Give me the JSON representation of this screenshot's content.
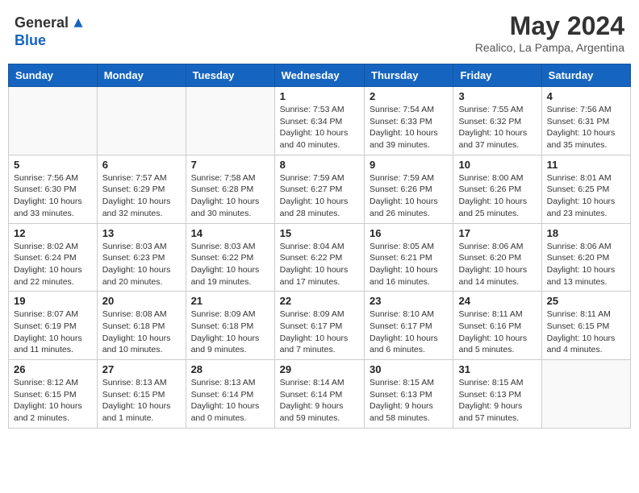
{
  "header": {
    "logo_general": "General",
    "logo_blue": "Blue",
    "month_title": "May 2024",
    "location": "Realico, La Pampa, Argentina"
  },
  "weekdays": [
    "Sunday",
    "Monday",
    "Tuesday",
    "Wednesday",
    "Thursday",
    "Friday",
    "Saturday"
  ],
  "weeks": [
    [
      {
        "day": "",
        "info": ""
      },
      {
        "day": "",
        "info": ""
      },
      {
        "day": "",
        "info": ""
      },
      {
        "day": "1",
        "info": "Sunrise: 7:53 AM\nSunset: 6:34 PM\nDaylight: 10 hours\nand 40 minutes."
      },
      {
        "day": "2",
        "info": "Sunrise: 7:54 AM\nSunset: 6:33 PM\nDaylight: 10 hours\nand 39 minutes."
      },
      {
        "day": "3",
        "info": "Sunrise: 7:55 AM\nSunset: 6:32 PM\nDaylight: 10 hours\nand 37 minutes."
      },
      {
        "day": "4",
        "info": "Sunrise: 7:56 AM\nSunset: 6:31 PM\nDaylight: 10 hours\nand 35 minutes."
      }
    ],
    [
      {
        "day": "5",
        "info": "Sunrise: 7:56 AM\nSunset: 6:30 PM\nDaylight: 10 hours\nand 33 minutes."
      },
      {
        "day": "6",
        "info": "Sunrise: 7:57 AM\nSunset: 6:29 PM\nDaylight: 10 hours\nand 32 minutes."
      },
      {
        "day": "7",
        "info": "Sunrise: 7:58 AM\nSunset: 6:28 PM\nDaylight: 10 hours\nand 30 minutes."
      },
      {
        "day": "8",
        "info": "Sunrise: 7:59 AM\nSunset: 6:27 PM\nDaylight: 10 hours\nand 28 minutes."
      },
      {
        "day": "9",
        "info": "Sunrise: 7:59 AM\nSunset: 6:26 PM\nDaylight: 10 hours\nand 26 minutes."
      },
      {
        "day": "10",
        "info": "Sunrise: 8:00 AM\nSunset: 6:26 PM\nDaylight: 10 hours\nand 25 minutes."
      },
      {
        "day": "11",
        "info": "Sunrise: 8:01 AM\nSunset: 6:25 PM\nDaylight: 10 hours\nand 23 minutes."
      }
    ],
    [
      {
        "day": "12",
        "info": "Sunrise: 8:02 AM\nSunset: 6:24 PM\nDaylight: 10 hours\nand 22 minutes."
      },
      {
        "day": "13",
        "info": "Sunrise: 8:03 AM\nSunset: 6:23 PM\nDaylight: 10 hours\nand 20 minutes."
      },
      {
        "day": "14",
        "info": "Sunrise: 8:03 AM\nSunset: 6:22 PM\nDaylight: 10 hours\nand 19 minutes."
      },
      {
        "day": "15",
        "info": "Sunrise: 8:04 AM\nSunset: 6:22 PM\nDaylight: 10 hours\nand 17 minutes."
      },
      {
        "day": "16",
        "info": "Sunrise: 8:05 AM\nSunset: 6:21 PM\nDaylight: 10 hours\nand 16 minutes."
      },
      {
        "day": "17",
        "info": "Sunrise: 8:06 AM\nSunset: 6:20 PM\nDaylight: 10 hours\nand 14 minutes."
      },
      {
        "day": "18",
        "info": "Sunrise: 8:06 AM\nSunset: 6:20 PM\nDaylight: 10 hours\nand 13 minutes."
      }
    ],
    [
      {
        "day": "19",
        "info": "Sunrise: 8:07 AM\nSunset: 6:19 PM\nDaylight: 10 hours\nand 11 minutes."
      },
      {
        "day": "20",
        "info": "Sunrise: 8:08 AM\nSunset: 6:18 PM\nDaylight: 10 hours\nand 10 minutes."
      },
      {
        "day": "21",
        "info": "Sunrise: 8:09 AM\nSunset: 6:18 PM\nDaylight: 10 hours\nand 9 minutes."
      },
      {
        "day": "22",
        "info": "Sunrise: 8:09 AM\nSunset: 6:17 PM\nDaylight: 10 hours\nand 7 minutes."
      },
      {
        "day": "23",
        "info": "Sunrise: 8:10 AM\nSunset: 6:17 PM\nDaylight: 10 hours\nand 6 minutes."
      },
      {
        "day": "24",
        "info": "Sunrise: 8:11 AM\nSunset: 6:16 PM\nDaylight: 10 hours\nand 5 minutes."
      },
      {
        "day": "25",
        "info": "Sunrise: 8:11 AM\nSunset: 6:15 PM\nDaylight: 10 hours\nand 4 minutes."
      }
    ],
    [
      {
        "day": "26",
        "info": "Sunrise: 8:12 AM\nSunset: 6:15 PM\nDaylight: 10 hours\nand 2 minutes."
      },
      {
        "day": "27",
        "info": "Sunrise: 8:13 AM\nSunset: 6:15 PM\nDaylight: 10 hours\nand 1 minute."
      },
      {
        "day": "28",
        "info": "Sunrise: 8:13 AM\nSunset: 6:14 PM\nDaylight: 10 hours\nand 0 minutes."
      },
      {
        "day": "29",
        "info": "Sunrise: 8:14 AM\nSunset: 6:14 PM\nDaylight: 9 hours\nand 59 minutes."
      },
      {
        "day": "30",
        "info": "Sunrise: 8:15 AM\nSunset: 6:13 PM\nDaylight: 9 hours\nand 58 minutes."
      },
      {
        "day": "31",
        "info": "Sunrise: 8:15 AM\nSunset: 6:13 PM\nDaylight: 9 hours\nand 57 minutes."
      },
      {
        "day": "",
        "info": ""
      }
    ]
  ]
}
